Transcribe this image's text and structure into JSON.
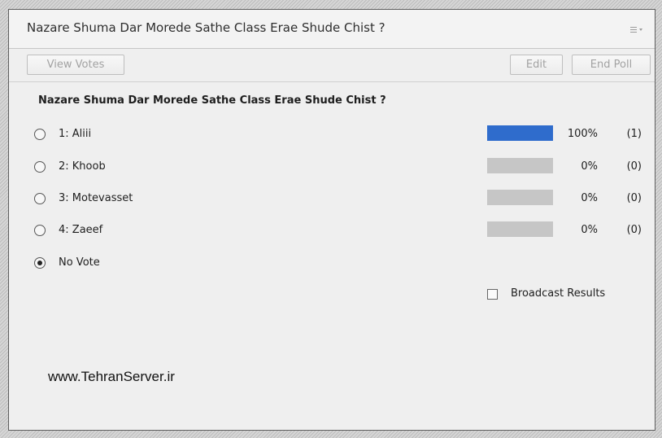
{
  "pod": {
    "title": "Nazare Shuma Dar Morede Sathe Class Erae Shude Chist ?",
    "menu_icon": "options-menu-icon"
  },
  "toolbar": {
    "view_votes_label": "View Votes",
    "edit_label": "Edit",
    "end_poll_label": "End Poll"
  },
  "poll": {
    "question": "Nazare Shuma Dar Morede Sathe Class Erae Shude Chist ?",
    "answers": [
      {
        "label": "1: Aliii",
        "percent_text": "100%",
        "count_text": "(1)",
        "fraction": 1.0
      },
      {
        "label": "2: Khoob",
        "percent_text": "0%",
        "count_text": "(0)",
        "fraction": 0
      },
      {
        "label": "3: Motevasset",
        "percent_text": "0%",
        "count_text": "(0)",
        "fraction": 0
      },
      {
        "label": "4: Zaeef",
        "percent_text": "0%",
        "count_text": "(0)",
        "fraction": 0
      }
    ],
    "no_vote_label": "No Vote",
    "selected": "No Vote"
  },
  "broadcast": {
    "label": "Broadcast Results",
    "checked": false
  },
  "watermark": "www.TehranServer.ir",
  "colors": {
    "bar_fill": "#2f6ccc",
    "bar_track": "#c6c6c6"
  }
}
